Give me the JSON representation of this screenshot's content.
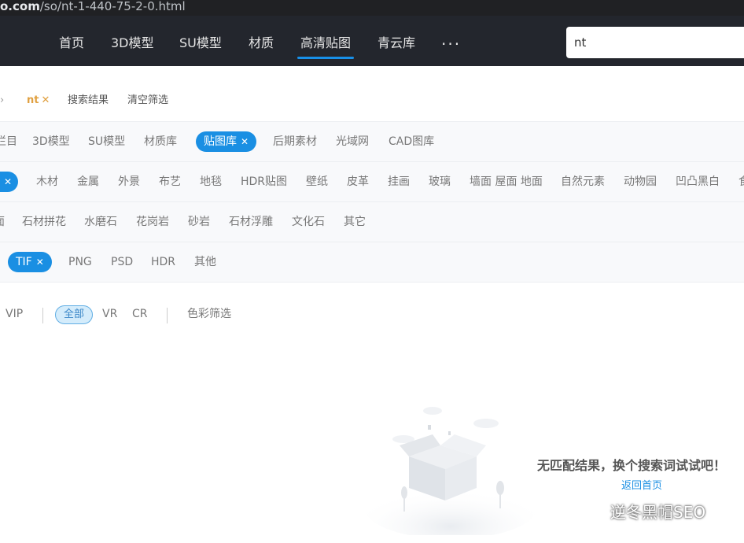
{
  "browser": {
    "url_host": "o.com",
    "url_path": "/so/nt-1-440-75-2-0.html"
  },
  "nav": {
    "items": [
      "首页",
      "3D模型",
      "SU模型",
      "材质",
      "高清贴图",
      "青云库"
    ],
    "active_index": 4,
    "more_label": "···",
    "search_value": "nt"
  },
  "crumbs": {
    "arrow": "›",
    "tag": "nt",
    "tag_close": "✕",
    "results": "搜索结果",
    "clear": "清空筛选"
  },
  "rows": {
    "category": {
      "items": [
        "栏目",
        "3D模型",
        "SU模型",
        "材质库",
        "贴图库",
        "后期素材",
        "光域网",
        "CAD图库"
      ],
      "selected": "贴图库"
    },
    "subcategory": {
      "items": [
        "",
        "木材",
        "金属",
        "外景",
        "布艺",
        "地毯",
        "HDR贴图",
        "壁纸",
        "皮革",
        "挂画",
        "玻璃",
        "墙面 屋面 地面",
        "自然元素",
        "动物园",
        "凹凸黑白",
        "食"
      ],
      "selected_index": 0
    },
    "stone": {
      "items": [
        "面",
        "石材拼花",
        "水磨石",
        "花岗岩",
        "砂岩",
        "石材浮雕",
        "文化石",
        "其它"
      ]
    },
    "format": {
      "items": [
        "TIF",
        "PNG",
        "PSD",
        "HDR",
        "其他"
      ],
      "selected": "TIF"
    }
  },
  "options": {
    "vip": "VIP",
    "all": "全部",
    "vr": "VR",
    "cr": "CR",
    "color": "色彩筛选"
  },
  "empty": {
    "title": "无匹配结果，换个搜索词试试吧！",
    "link": "返回首页"
  },
  "watermark": {
    "text": "逆冬黑帽SEO"
  },
  "colors": {
    "accent": "#1a8fe3",
    "nav_bg": "#23262d",
    "tag_orange": "#e0a040"
  }
}
